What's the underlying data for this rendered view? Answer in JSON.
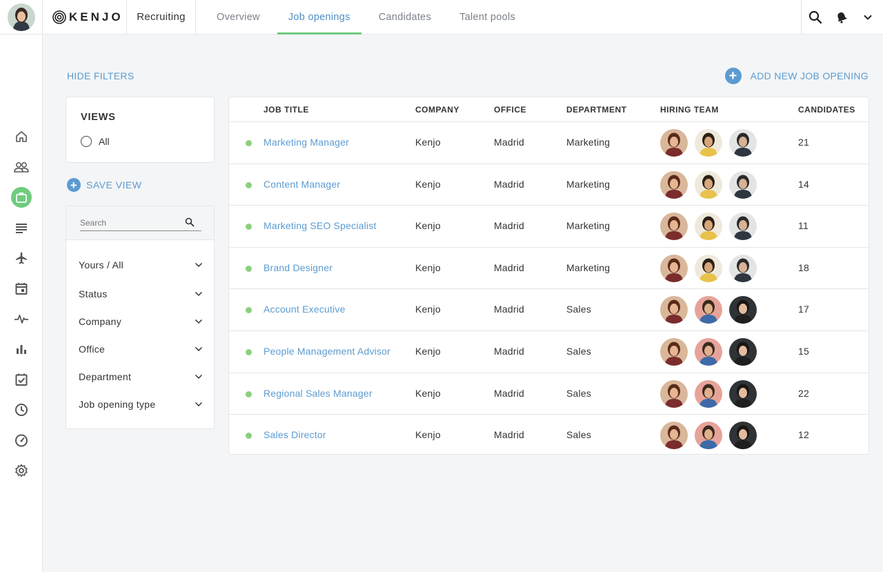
{
  "topbar": {
    "logo": "KENJO",
    "module": "Recruiting",
    "tabs": [
      {
        "label": "Overview",
        "active": false
      },
      {
        "label": "Job openings",
        "active": true
      },
      {
        "label": "Candidates",
        "active": false
      },
      {
        "label": "Talent pools",
        "active": false
      }
    ],
    "icons": [
      "search-icon",
      "notifications-icon",
      "chevron-down-icon"
    ]
  },
  "sidebar": {
    "items": [
      {
        "icon": "home-icon"
      },
      {
        "icon": "people-icon"
      },
      {
        "icon": "briefcase-icon",
        "active": true
      },
      {
        "icon": "documents-icon"
      },
      {
        "icon": "airplane-icon"
      },
      {
        "icon": "calendar-icon"
      },
      {
        "icon": "pulse-icon"
      },
      {
        "icon": "bar-chart-icon"
      },
      {
        "icon": "checklist-icon"
      },
      {
        "icon": "clock-icon"
      },
      {
        "icon": "speedometer-icon"
      },
      {
        "icon": "settings-icon"
      }
    ]
  },
  "actions": {
    "hide_filters": "HIDE FILTERS",
    "add_job": "ADD NEW JOB OPENING",
    "save_view": "SAVE VIEW"
  },
  "views": {
    "title": "VIEWS",
    "options": [
      {
        "label": "All",
        "selected": false
      }
    ]
  },
  "search": {
    "placeholder": "Search",
    "value": ""
  },
  "filters": [
    "Yours / All",
    "Status",
    "Company",
    "Office",
    "Department",
    "Job opening type"
  ],
  "table": {
    "columns": [
      "JOB TITLE",
      "COMPANY",
      "OFFICE",
      "DEPARTMENT",
      "HIRING TEAM",
      "CANDIDATES"
    ],
    "rows": [
      {
        "title": "Marketing Manager",
        "company": "Kenjo",
        "office": "Madrid",
        "department": "Marketing",
        "team": "marketing",
        "candidates": "21"
      },
      {
        "title": "Content Manager",
        "company": "Kenjo",
        "office": "Madrid",
        "department": "Marketing",
        "team": "marketing",
        "candidates": "14"
      },
      {
        "title": "Marketing SEO Specialist",
        "company": "Kenjo",
        "office": "Madrid",
        "department": "Marketing",
        "team": "marketing",
        "candidates": "11"
      },
      {
        "title": "Brand Designer",
        "company": "Kenjo",
        "office": "Madrid",
        "department": "Marketing",
        "team": "marketing",
        "candidates": "18"
      },
      {
        "title": "Account Executive",
        "company": "Kenjo",
        "office": "Madrid",
        "department": "Sales",
        "team": "sales",
        "candidates": "17"
      },
      {
        "title": "People Management Advisor",
        "company": "Kenjo",
        "office": "Madrid",
        "department": "Sales",
        "team": "sales",
        "candidates": "15"
      },
      {
        "title": "Regional Sales Manager",
        "company": "Kenjo",
        "office": "Madrid",
        "department": "Sales",
        "team": "sales",
        "candidates": "22"
      },
      {
        "title": "Sales Director",
        "company": "Kenjo",
        "office": "Madrid",
        "department": "Sales",
        "team": "sales",
        "candidates": "12"
      }
    ]
  },
  "colors": {
    "accent": "#5b9bd1",
    "green": "#6fcb7e",
    "status_active": "#8bd17c"
  }
}
